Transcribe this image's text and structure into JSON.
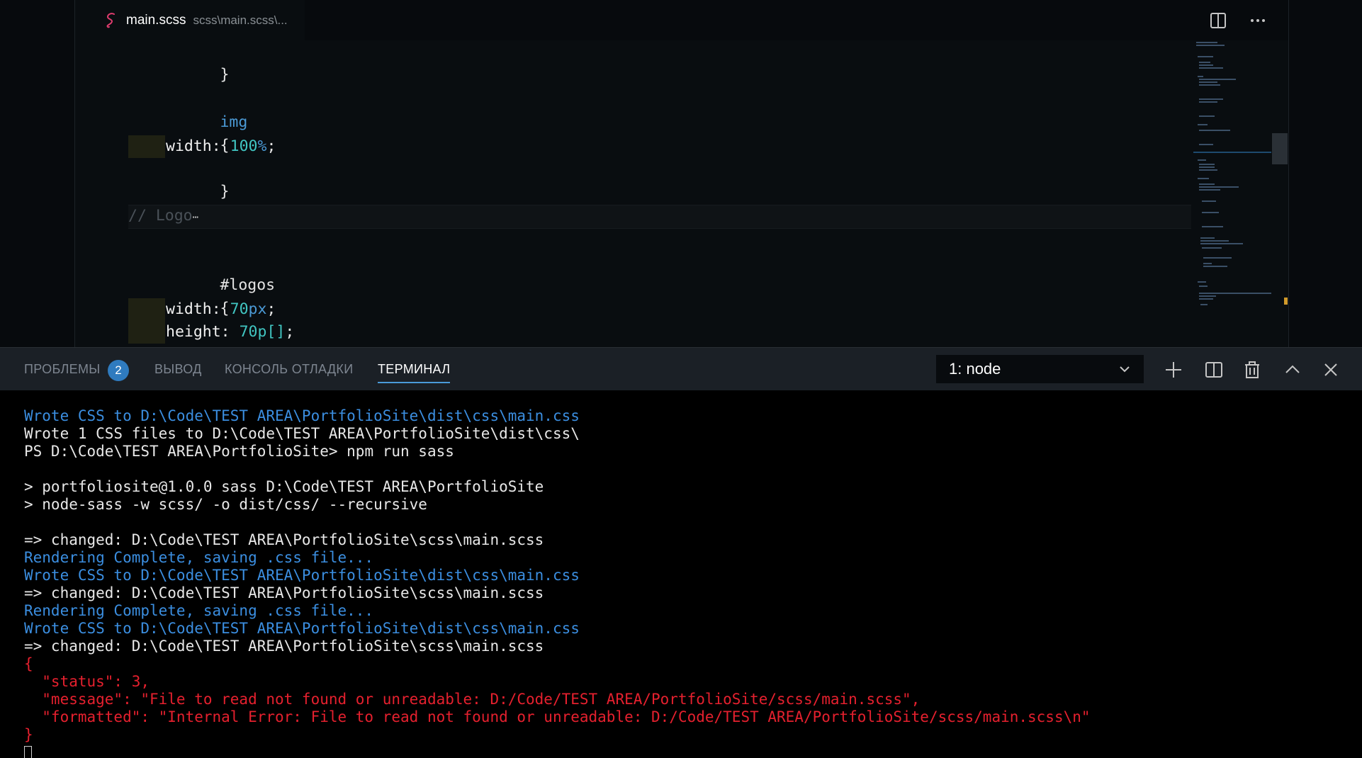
{
  "editor": {
    "tab": {
      "filename": "main.scss",
      "path": "scss\\main.scss\\...",
      "icon": "sass-file-icon",
      "icon_color": "#e03c6e"
    },
    "actions": {
      "split_icon": "split-editor-icon",
      "more_icon": "more-actions-icon"
    },
    "code": {
      "line1": "}",
      "line2_selector": "img",
      "line3": "{",
      "line4_prop": "width",
      "line4_colon": ":",
      "line4_num": "100",
      "line4_unit": "%",
      "line4_semi": ";",
      "line5": "}",
      "line6_comment": "// Logo",
      "line6_fold": "⋯",
      "line7_selector": "#logos",
      "line8": "{",
      "line9_prop": "width",
      "line9_colon": ":",
      "line9_num": "70",
      "line9_unit": "px",
      "line9_semi": ";",
      "line10_prop": "height",
      "line10_colon": ":",
      "line10_num": "70p[]",
      "line10_semi": ";"
    }
  },
  "panel": {
    "tabs": {
      "problems": "ПРОБЛЕМЫ",
      "problems_count": "2",
      "output": "ВЫВОД",
      "debug_console": "КОНСОЛЬ ОТЛАДКИ",
      "terminal": "ТЕРМИНАЛ"
    },
    "terminal_select": {
      "value": "1: node"
    },
    "actions": {
      "new_terminal_icon": "plus-icon",
      "split_terminal_icon": "split-terminal-icon",
      "kill_terminal_icon": "trash-icon",
      "maximize_icon": "chevron-up-icon",
      "close_icon": "close-icon"
    }
  },
  "terminal": {
    "lines": {
      "l1": "Wrote CSS to D:\\Code\\TEST AREA\\PortfolioSite\\dist\\css\\main.css",
      "l2": "Wrote 1 CSS files to D:\\Code\\TEST AREA\\PortfolioSite\\dist\\css\\",
      "l3_prompt": "PS D:\\Code\\TEST AREA\\PortfolioSite> ",
      "l3_cmd": "npm run sass",
      "l5": "> portfoliosite@1.0.0 sass D:\\Code\\TEST AREA\\PortfolioSite",
      "l6": "> node-sass -w scss/ -o dist/css/ --recursive",
      "l8": "=> changed: D:\\Code\\TEST AREA\\PortfolioSite\\scss\\main.scss",
      "l9": "Rendering Complete, saving .css file...",
      "l10": "Wrote CSS to D:\\Code\\TEST AREA\\PortfolioSite\\dist\\css\\main.css",
      "l11": "=> changed: D:\\Code\\TEST AREA\\PortfolioSite\\scss\\main.scss",
      "l12": "Rendering Complete, saving .css file...",
      "l13": "Wrote CSS to D:\\Code\\TEST AREA\\PortfolioSite\\dist\\css\\main.css",
      "l14": "=> changed: D:\\Code\\TEST AREA\\PortfolioSite\\scss\\main.scss",
      "l15": "{",
      "l16": "  \"status\": 3,",
      "l17": "  \"message\": \"File to read not found or unreadable: D:/Code/TEST AREA/PortfolioSite/scss/main.scss\",",
      "l18": "  \"formatted\": \"Internal Error: File to read not found or unreadable: D:/Code/TEST AREA/PortfolioSite/scss/main.scss\\n\"",
      "l19": "}"
    }
  },
  "colors": {
    "terminal_info": "#3b8ee0",
    "terminal_error": "#e5202e",
    "accent": "#2f7bbf"
  }
}
